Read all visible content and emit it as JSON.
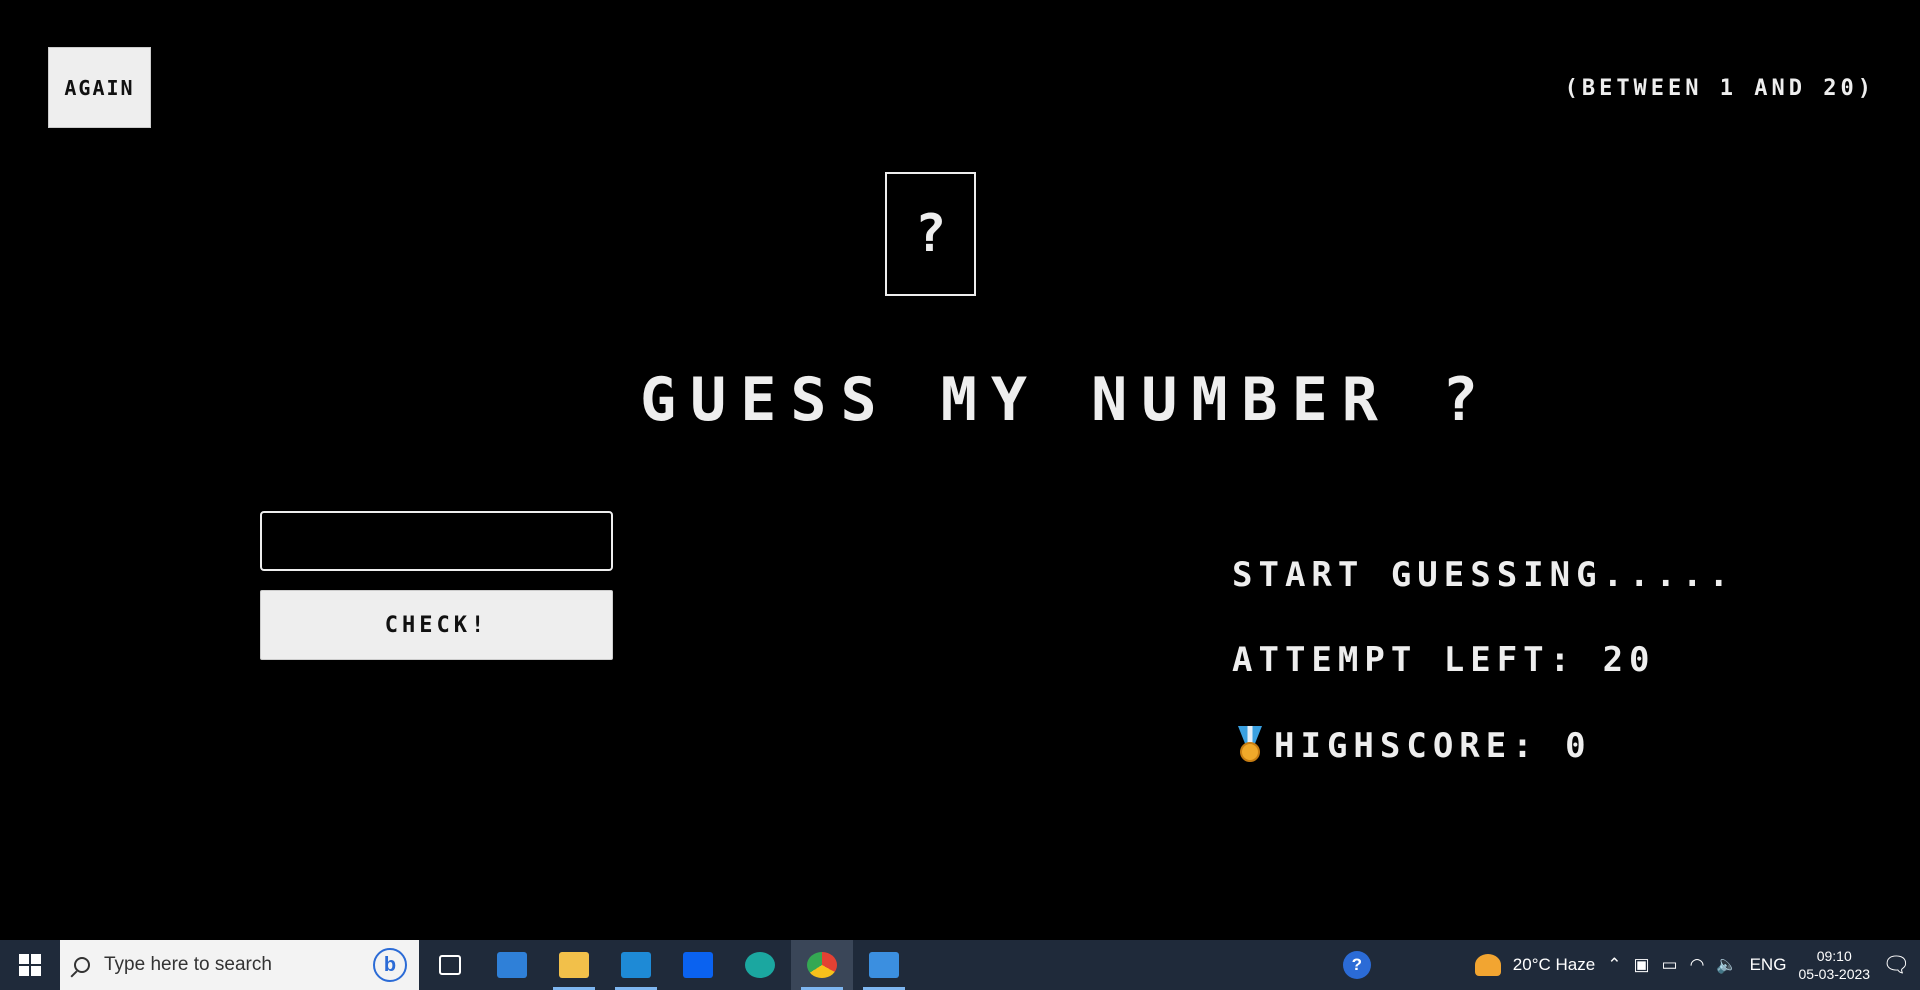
{
  "game": {
    "again_label": "AGAIN",
    "range_hint": "(BETWEEN 1 AND 20)",
    "secret_number": "?",
    "title": "GUESS MY NUMBER ?",
    "guess_value": "",
    "check_label": "CHECK!",
    "status_message": "START GUESSING.....",
    "attempts_label": "ATTEMPT LEFT: 20",
    "highscore_label": "HIGHSCORE: 0"
  },
  "taskbar": {
    "search_placeholder": "Type here to search",
    "bing_label": "b",
    "apps": [
      "task-view",
      "mail",
      "file-explorer",
      "vs-code",
      "dropbox",
      "edge",
      "chrome",
      "photos"
    ],
    "weather": "20°C  Haze",
    "language": "ENG",
    "time": "09:10",
    "date": "05-03-2023"
  }
}
